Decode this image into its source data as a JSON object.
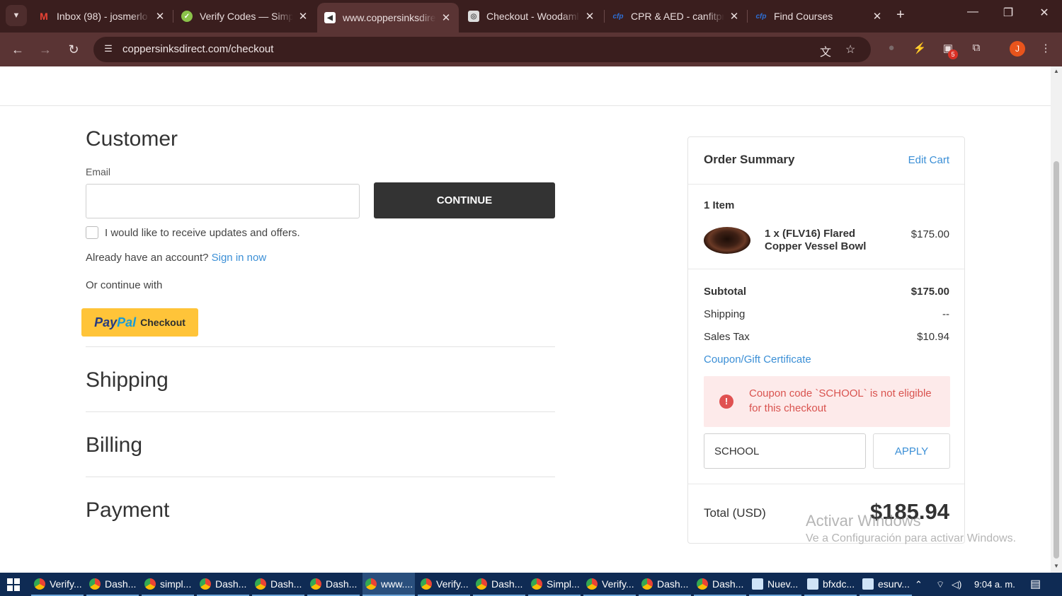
{
  "browser": {
    "tabs": [
      {
        "title": "Inbox (98) - josmerlo",
        "icon": "gmail-icon",
        "active": false
      },
      {
        "title": "Verify Codes — Simpl",
        "icon": "verify-icon",
        "active": false
      },
      {
        "title": "www.coppersinksdire",
        "icon": "site-favicon",
        "active": true
      },
      {
        "title": "Checkout - Woodaml",
        "icon": "woodaml-icon",
        "active": false
      },
      {
        "title": "CPR & AED - canfitpr",
        "icon": "cfp-icon",
        "active": false
      },
      {
        "title": "Find Courses",
        "icon": "cfp-icon",
        "active": false
      }
    ],
    "url": "coppersinksdirect.com/checkout",
    "extension_badge": "5",
    "profile_initial": "J"
  },
  "customer": {
    "heading": "Customer",
    "email_label": "Email",
    "email_value": "",
    "continue_label": "CONTINUE",
    "updates_label": "I would like to receive updates and offers.",
    "account_prompt": "Already have an account?",
    "sign_in_label": "Sign in now",
    "or_continue": "Or continue with",
    "paypal_logo_a": "Pay",
    "paypal_logo_b": "Pal",
    "paypal_text": "Checkout"
  },
  "sections": {
    "shipping": "Shipping",
    "billing": "Billing",
    "payment": "Payment"
  },
  "summary": {
    "title": "Order Summary",
    "edit_cart": "Edit Cart",
    "item_count": "1 Item",
    "item_name": "1 x (FLV16) Flared Copper Vessel Bowl",
    "item_price": "$175.00",
    "subtotal_label": "Subtotal",
    "subtotal_value": "$175.00",
    "shipping_label": "Shipping",
    "shipping_value": "--",
    "tax_label": "Sales Tax",
    "tax_value": "$10.94",
    "coupon_link": "Coupon/Gift Certificate",
    "alert_text": "Coupon code `SCHOOL` is not eligible for this checkout",
    "coupon_value": "SCHOOL",
    "apply_label": "APPLY",
    "total_label": "Total (USD)",
    "total_value": "$185.94"
  },
  "watermark": {
    "line1": "Activar Windows",
    "line2": "Ve a Configuración para activar Windows."
  },
  "taskbar": {
    "items": [
      "Verify...",
      "Dash...",
      "simpl...",
      "Dash...",
      "Dash...",
      "Dash...",
      "www....",
      "Verify...",
      "Dash...",
      "Simpl...",
      "Verify...",
      "Dash...",
      "Dash...",
      "Nuev...",
      "bfxdc...",
      "esurv..."
    ],
    "clock": "9:04 a. m."
  },
  "colors": {
    "accent_link": "#3b8fd6",
    "paypal_yellow": "#ffc439",
    "chrome_dark": "#3a1e1e",
    "chrome_toolbar": "#5a3434",
    "taskbar": "#0f2b54"
  }
}
